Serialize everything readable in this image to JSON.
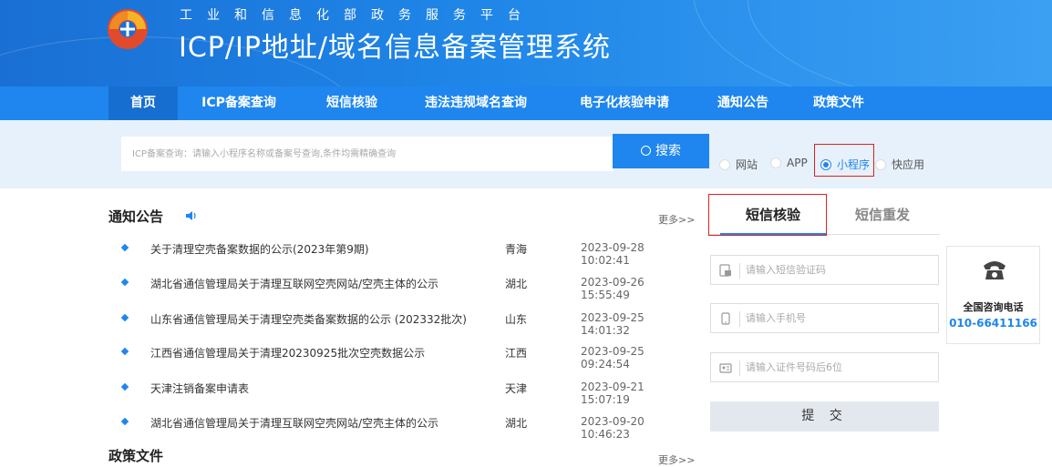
{
  "header": {
    "subtitle": "工业和信息化部政务服务平台",
    "title": "ICP/IP地址/域名信息备案管理系统"
  },
  "nav": {
    "items": [
      {
        "label": "首页",
        "active": true
      },
      {
        "label": "ICP备案查询"
      },
      {
        "label": "短信核验"
      },
      {
        "label": "违法违规域名查询"
      },
      {
        "label": "电子化核验申请"
      },
      {
        "label": "通知公告"
      },
      {
        "label": "政策文件"
      }
    ]
  },
  "search": {
    "placeholder": "ICP备案查询：请输入小程序名称或备案号查询,条件均需精确查询",
    "button": "搜索",
    "button_icon": "search-icon",
    "types": [
      {
        "label": "网站",
        "checked": false
      },
      {
        "label": "APP",
        "checked": false
      },
      {
        "label": "小程序",
        "checked": true
      },
      {
        "label": "快应用",
        "checked": false
      }
    ]
  },
  "notices": {
    "title": "通知公告",
    "icon": "speaker-icon",
    "more": "更多>>",
    "rows": [
      {
        "title": "关于清理空壳备案数据的公示(2023年第9期)",
        "province": "青海",
        "date": "2023-09-28 10:02:41"
      },
      {
        "title": "湖北省通信管理局关于清理互联网空壳网站/空壳主体的公示",
        "province": "湖北",
        "date": "2023-09-26 15:55:49"
      },
      {
        "title": "山东省通信管理局关于清理空壳类备案数据的公示 (202332批次)",
        "province": "山东",
        "date": "2023-09-25 14:01:32"
      },
      {
        "title": "江西省通信管理局关于清理20230925批次空壳数据公示",
        "province": "江西",
        "date": "2023-09-25 09:24:54"
      },
      {
        "title": "天津注销备案申请表",
        "province": "天津",
        "date": "2023-09-21 15:07:19"
      },
      {
        "title": "湖北省通信管理局关于清理互联网空壳网站/空壳主体的公示",
        "province": "湖北",
        "date": "2023-09-20 10:46:23"
      }
    ]
  },
  "policy": {
    "title": "政策文件",
    "more": "更多>>"
  },
  "sms": {
    "tabs": [
      {
        "label": "短信核验",
        "active": true
      },
      {
        "label": "短信重发",
        "active": false
      }
    ],
    "fields": [
      {
        "placeholder": "请输入短信验证码",
        "icon": "sms-code-icon"
      },
      {
        "placeholder": "请输入手机号",
        "icon": "mobile-phone-icon"
      },
      {
        "placeholder": "请输入证件号码后6位",
        "icon": "id-card-icon"
      }
    ],
    "submit": "提 交"
  },
  "hotline": {
    "label": "全国咨询电话",
    "number": "010-66411166",
    "icon": "telephone-icon"
  },
  "colors": {
    "primary": "#1e86ee",
    "highlight_box": "#e02020"
  }
}
